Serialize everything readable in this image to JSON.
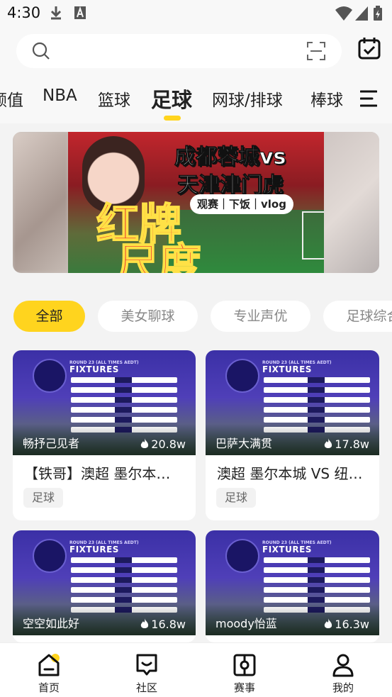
{
  "status_bar": {
    "time": "4:30",
    "icons": [
      "download-icon",
      "app-a-icon",
      "wifi-icon",
      "signal-icon",
      "battery-charging-icon"
    ]
  },
  "search": {
    "placeholder": "",
    "icons": [
      "search-icon",
      "scan-icon",
      "calendar-check-icon"
    ]
  },
  "tabs": {
    "items": [
      {
        "label": "颜值"
      },
      {
        "label": "NBA"
      },
      {
        "label": "篮球"
      },
      {
        "label": "足球",
        "active": true
      },
      {
        "label": "网球/排球"
      },
      {
        "label": "棒球"
      }
    ],
    "menu_icon": "menu-icon",
    "accent": "#ffd41e"
  },
  "banner": {
    "title_line1": "成都蓉城vs",
    "title_line2": "天津津门虎",
    "tag": "观赛｜下饭｜vlog",
    "big_text_line1": "红牌",
    "big_text_line2": "尺度"
  },
  "chips": [
    {
      "label": "全部",
      "active": true
    },
    {
      "label": "美女聊球"
    },
    {
      "label": "专业声优"
    },
    {
      "label": "足球综合"
    }
  ],
  "thumbnail_text": {
    "fixtures": "FIXTURES",
    "round": "ROUND 23 (ALL TIMES AEDT)"
  },
  "cards": [
    {
      "author": "畅抒己见者",
      "views": "20.8w",
      "title": "【铁哥】澳超 墨尔本…",
      "tag": "足球"
    },
    {
      "author": "巴萨大满贯",
      "views": "17.8w",
      "title": "澳超 墨尔本城 VS 纽…",
      "tag": "足球"
    },
    {
      "author": "空空如此好",
      "views": "16.8w"
    },
    {
      "author": "moody怡蓝",
      "views": "16.3w"
    }
  ],
  "bottom_nav": [
    {
      "label": "首页",
      "icon": "home-icon",
      "active": true
    },
    {
      "label": "社区",
      "icon": "community-icon"
    },
    {
      "label": "赛事",
      "icon": "match-icon"
    },
    {
      "label": "我的",
      "icon": "profile-icon"
    }
  ]
}
